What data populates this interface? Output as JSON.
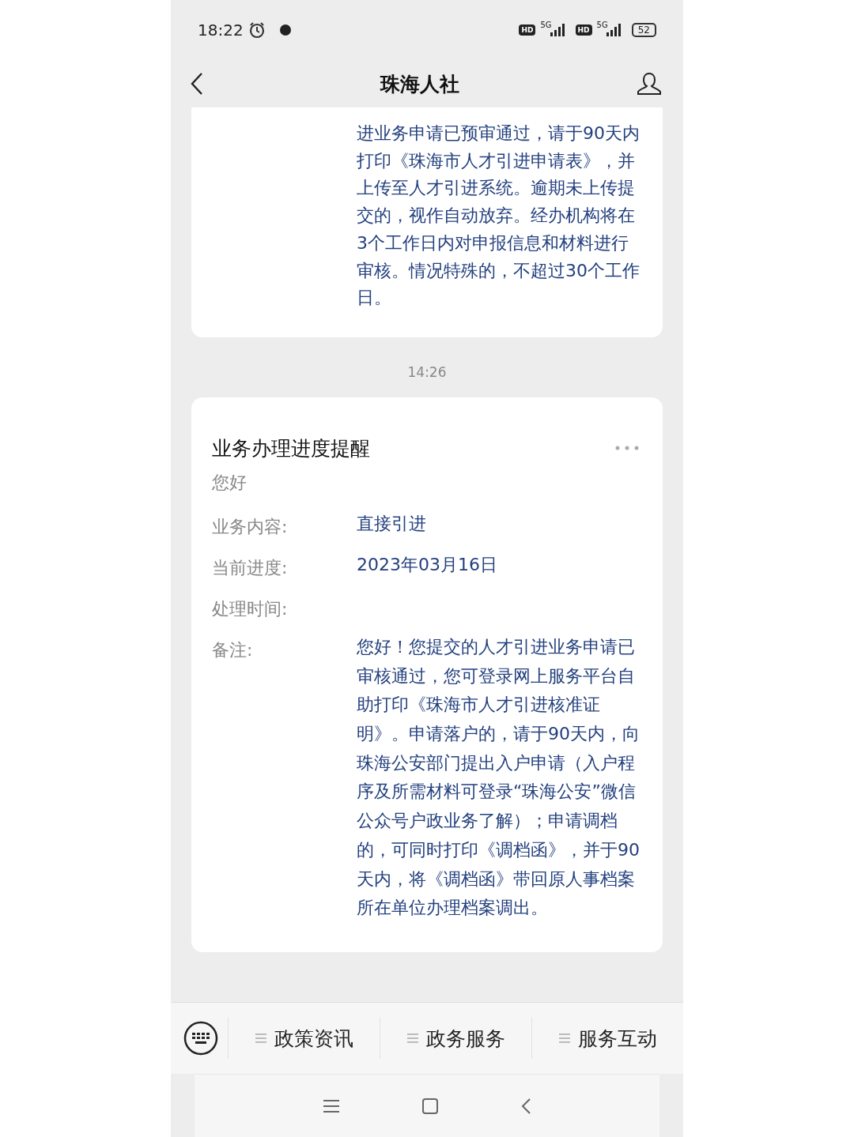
{
  "status_bar": {
    "time": "18:22",
    "signals": [
      {
        "badge": "HD",
        "network": "5G"
      },
      {
        "badge": "HD",
        "network": "5G"
      }
    ],
    "battery": "52"
  },
  "header": {
    "title": "珠海人社"
  },
  "previous_card": {
    "remark": "进业务申请已预审通过，请于90天内打印《珠海市人才引进申请表》，并上传至人才引进系统。逾期未上传提交的，视作自动放弃。经办机构将在3个工作日内对申报信息和材料进行审核。情况特殊的，不超过30个工作日。"
  },
  "timestamp": "14:26",
  "card": {
    "title": "业务办理进度提醒",
    "greeting": "您好",
    "fields": [
      {
        "label": "业务内容:",
        "value": "直接引进"
      },
      {
        "label": "当前进度:",
        "value": "2023年03月16日"
      },
      {
        "label": "处理时间:"
      },
      {
        "label": "备注:",
        "value": "您好！您提交的人才引进业务申请已审核通过，您可登录网上服务平台自助打印《珠海市人才引进核准证明》。申请落户的，请于90天内，向珠海公安部门提出入户申请（入户程序及所需材料可登录“珠海公安”微信公众号户政业务了解）；申请调档的，可同时打印《调档函》，并于90天内，将《调档函》带回原人事档案所在单位办理档案调出。"
      }
    ]
  },
  "menu": [
    {
      "label": "政策资讯"
    },
    {
      "label": "政务服务"
    },
    {
      "label": "服务互动"
    }
  ]
}
